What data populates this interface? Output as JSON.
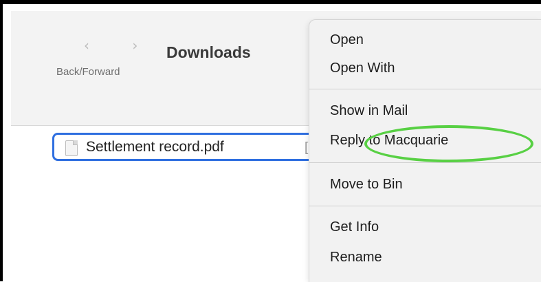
{
  "toolbar": {
    "nav_arrows": "‹ ›",
    "nav_label": "Back/Forward",
    "title": "Downloads"
  },
  "file": {
    "name": "Settlement record.pdf",
    "icon": "pdf-file-icon",
    "trail": "["
  },
  "context_menu": {
    "items": [
      {
        "label": "Open"
      },
      {
        "label": "Open With"
      },
      {
        "label": "Show in Mail"
      },
      {
        "label": "Reply to Macquarie"
      },
      {
        "label": "Move to Bin"
      },
      {
        "label": "Get Info"
      },
      {
        "label": "Rename"
      }
    ]
  },
  "colors": {
    "selection_border": "#2f6fe0",
    "highlight_ring": "#58d044",
    "menu_background": "#f2f2f2"
  }
}
